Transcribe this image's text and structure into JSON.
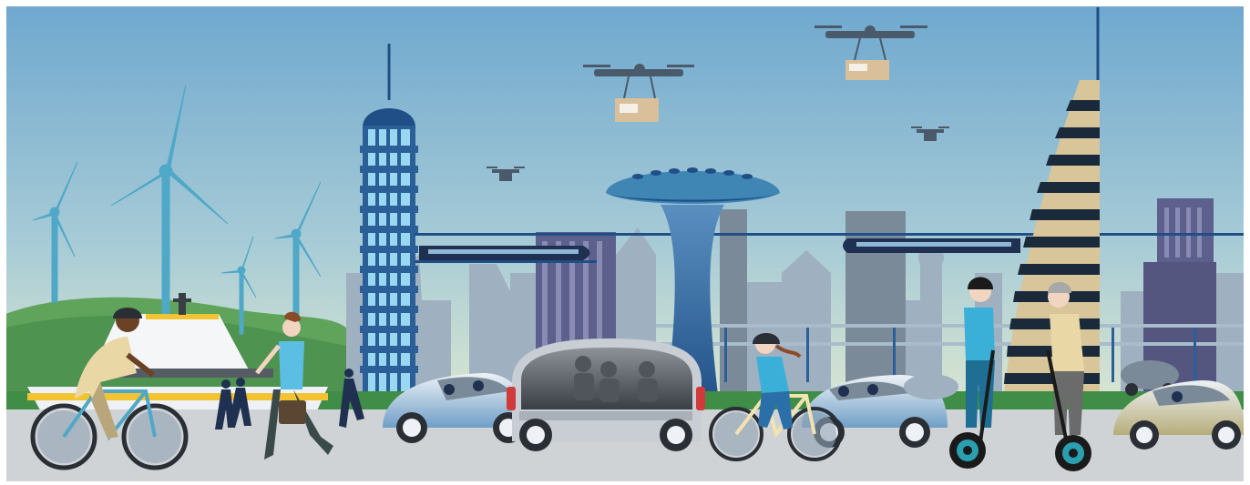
{
  "scene": {
    "colors": {
      "sky_top": "#6fa8cf",
      "sky_bottom": "#e4ecd0",
      "road": "#cfd3d6",
      "accent_blue": "#1f4f86",
      "vehicle_silver": "#c9ced4",
      "hill_green": "#5fa45a"
    },
    "elements": [
      "wind-turbines",
      "ferry-ship",
      "skyscrapers",
      "mushroom-tower",
      "striped-tower",
      "delivery-drones",
      "monorail-trains",
      "autonomous-pod-vehicle",
      "electric-cars",
      "cyclists",
      "pedestrians",
      "segway-riders"
    ]
  }
}
